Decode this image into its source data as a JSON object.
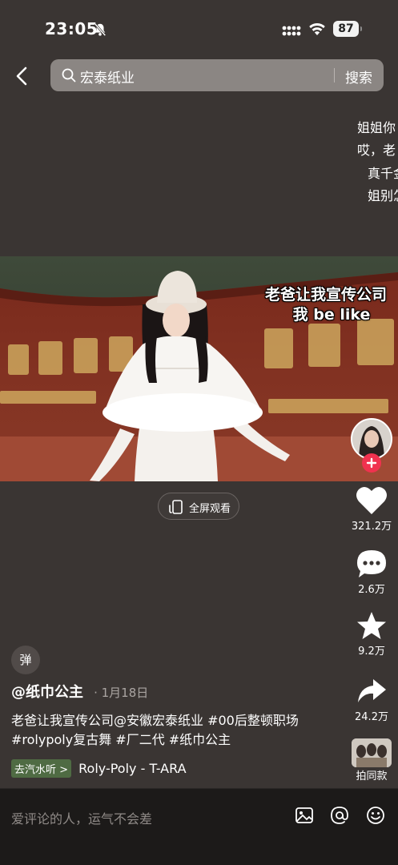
{
  "status": {
    "time": "23:05",
    "battery": "87"
  },
  "search": {
    "query": "宏泰纸业",
    "button": "搜索"
  },
  "overlay_comments": [
    "姐姐你",
    "哎，老",
    "真千金",
    "姐别怎"
  ],
  "video": {
    "caption_line1": "老爸让我宣传公司",
    "caption_line2": "我 be like"
  },
  "fullscreen_label": "全屏观看",
  "actions": {
    "likes": "321.2万",
    "comments": "2.6万",
    "favorites": "9.2万",
    "shares": "24.2万",
    "same_style": "拍同款"
  },
  "danmu_label": "弹",
  "author": {
    "name": "@纸巾公主",
    "date": "· 1月18日"
  },
  "description": {
    "line1": "老爸让我宣传公司@安徽宏泰纸业 #00后整顿职场",
    "line2": "#rolypoly复古舞 #厂二代 #纸巾公主"
  },
  "music": {
    "tag": "去汽水听 >",
    "title": "Roly-Poly - T-ARA"
  },
  "comment_bar": {
    "placeholder": "爱评论的人，运气不会差"
  }
}
